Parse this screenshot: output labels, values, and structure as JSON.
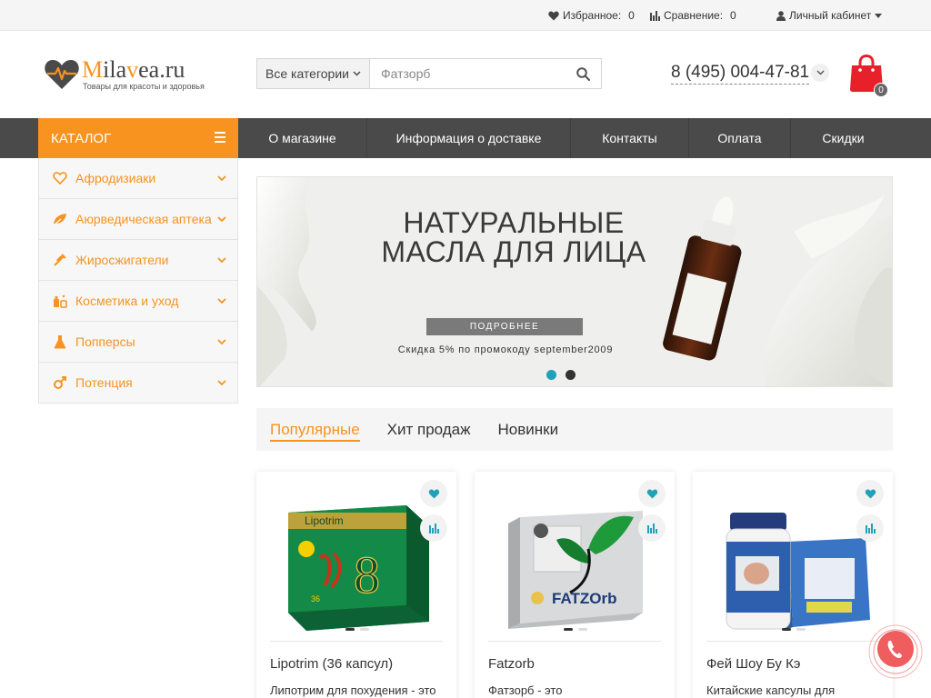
{
  "colors": {
    "accent": "#f7931e",
    "nav": "#4a4a4a",
    "teal": "#1fa2b8",
    "callback": "#f05d5e"
  },
  "topbar": {
    "favorites_label": "Избранное:",
    "favorites_count": "0",
    "compare_label": "Сравнение:",
    "compare_count": "0",
    "account_label": "Личный кабинет"
  },
  "header": {
    "logo_m": "M",
    "logo_ila": "ila",
    "logo_v": "v",
    "logo_rest": "ea.ru",
    "logo_tagline": "Товары для красоты и здоровья",
    "search_category": "Все категории",
    "search_placeholder": "Фатзорб",
    "phone": "8 (495) 004-47-81",
    "cart_count": "0"
  },
  "nav": {
    "catalog_label": "КАТАЛОГ",
    "links": [
      "О магазине",
      "Информация о доставке",
      "Контакты",
      "Оплата",
      "Скидки"
    ]
  },
  "sidebar": {
    "items": [
      {
        "label": "Афродизиаки",
        "icon": "heart-icon"
      },
      {
        "label": "Аюрведическая аптека",
        "icon": "leaf-icon"
      },
      {
        "label": "Жиросжигатели",
        "icon": "syringe-icon"
      },
      {
        "label": "Косметика и уход",
        "icon": "cosmetics-icon"
      },
      {
        "label": "Попперсы",
        "icon": "flask-icon"
      },
      {
        "label": "Потенция",
        "icon": "male-symbol-icon"
      }
    ]
  },
  "banner": {
    "title_line1": "НАТУРАЛЬНЫЕ",
    "title_line2": "МАСЛА ДЛЯ ЛИЦА",
    "button_label": "ПОДРОБНЕЕ",
    "promo_text": "Скидка 5% по промокоду september2009"
  },
  "tabs": [
    {
      "label": "Популярные",
      "active": true
    },
    {
      "label": "Хит продаж",
      "active": false
    },
    {
      "label": "Новинки",
      "active": false
    }
  ],
  "products": [
    {
      "name": "Lipotrim (36 капсул)",
      "desc": "Липотрим для похудения - это",
      "box_text": "Lipotrim",
      "box_number": "36"
    },
    {
      "name": "Fatzorb",
      "desc": "Фатзорб - это",
      "box_text": "FATZOrb"
    },
    {
      "name": "Фей Шоу Бу Кэ",
      "desc": "Китайские капсулы для"
    }
  ]
}
